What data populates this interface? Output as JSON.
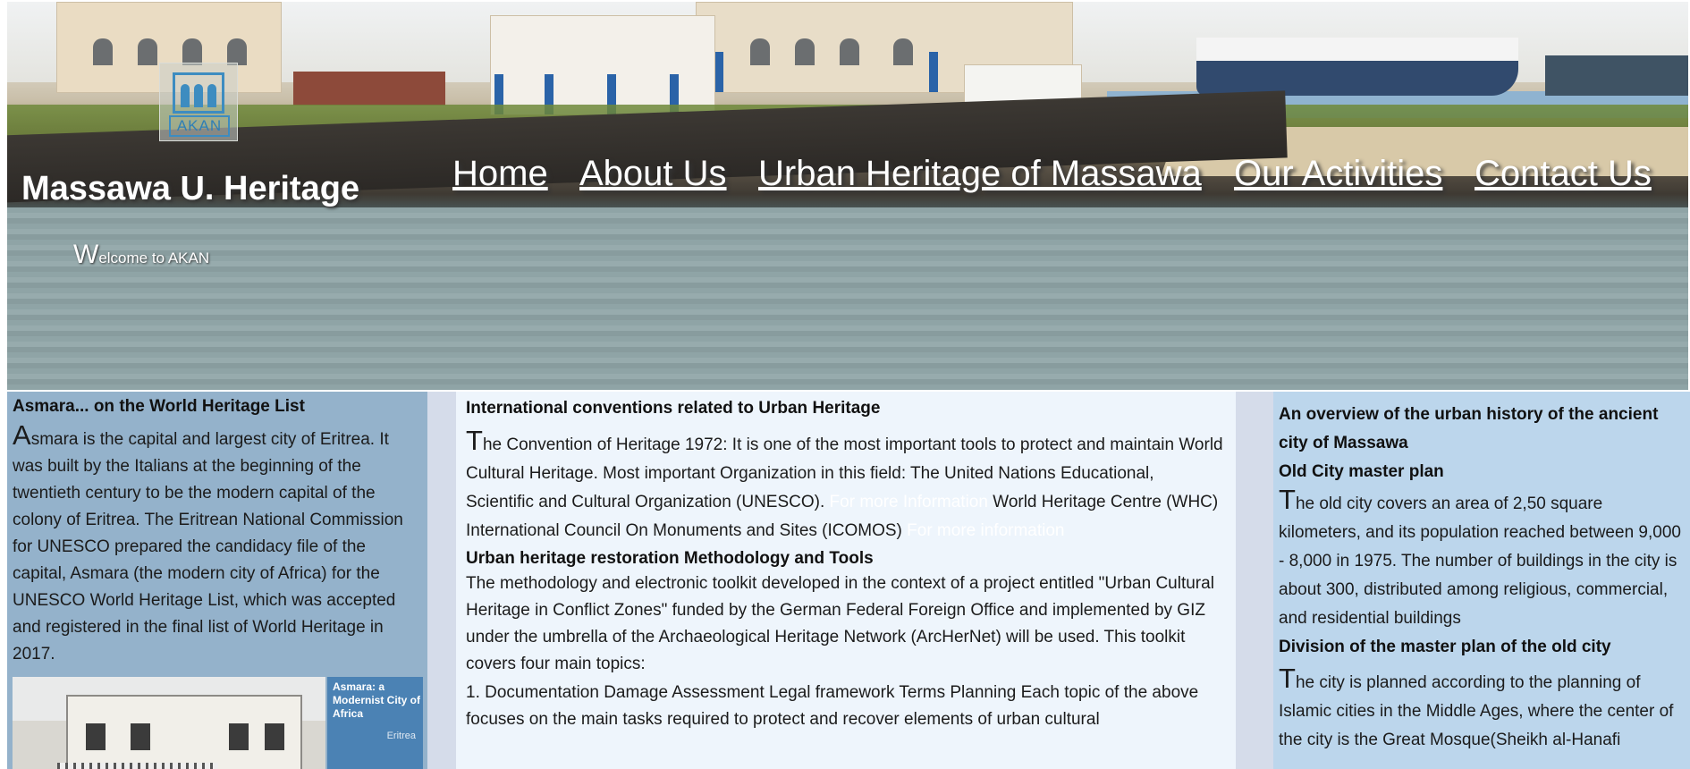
{
  "header": {
    "logo_text": "AKAN",
    "site_title": "Massawa U. Heritage",
    "welcome_first": "W",
    "welcome_rest": "elcome to AKAN"
  },
  "nav": {
    "items": [
      "Home",
      "About Us",
      "Urban Heritage of Massawa",
      "Our Activities",
      "Contact Us"
    ]
  },
  "left": {
    "heading": "Asmara... on the World Heritage List",
    "drop": "A",
    "text": "smara is the capital and largest city of Eritrea. It was built by the Italians at the beginning of the twentieth century to be the modern capital of the colony of Eritrea. The Eritrean National Commission for UNESCO prepared the candidacy file of the capital, Asmara (the modern city of Africa) for the UNESCO World Heritage List, which was accepted and registered in the final list of World Heritage in 2017.",
    "book_title": "Asmara: a Modernist City of Africa",
    "book_sub": "Eritrea"
  },
  "middle": {
    "heading1": "International conventions related to Urban Heritage",
    "drop": "T",
    "p1_a": "he Convention of Heritage 1972: It is one of the most important tools to protect and maintain World Cultural Heritage. Most important Organization in this field: The United Nations Educational, Scientific and Cultural Organization (UNESCO). ",
    "link1": "For more Information",
    "p1_b": " World Heritage Centre (WHC) International Council On Monuments and Sites (ICOMOS) ",
    "link2": "For more information",
    "heading2": "Urban heritage restoration Methodology and Tools",
    "p2": "The methodology and electronic toolkit developed in the context of a project entitled \"Urban Cultural Heritage in Conflict Zones\" funded by the German Federal Foreign Office and implemented by GIZ under the umbrella of the Archaeological Heritage Network (ArcHerNet) will be used. This toolkit covers four main topics:",
    "p3": "1. Documentation Damage Assessment Legal framework Terms Planning Each topic of the above focuses on the main tasks required to protect and recover elements of urban cultural"
  },
  "right": {
    "heading1": "An overview of the urban history of the ancient city of Massawa",
    "heading2": "Old City master plan",
    "drop1": "T",
    "p1": "he old city covers an area of 2,50 square kilometers, and its population reached between 9,000 - 8,000 in 1975. The number of buildings in the city is about 300, distributed among religious, commercial, and residential buildings",
    "heading3": "Division of the master plan of the old city",
    "drop2": "T",
    "p2": "he city is planned according to the planning of Islamic cities in the Middle Ages, where the center of the city is the Great Mosque(Sheikh al-Hanafi"
  }
}
